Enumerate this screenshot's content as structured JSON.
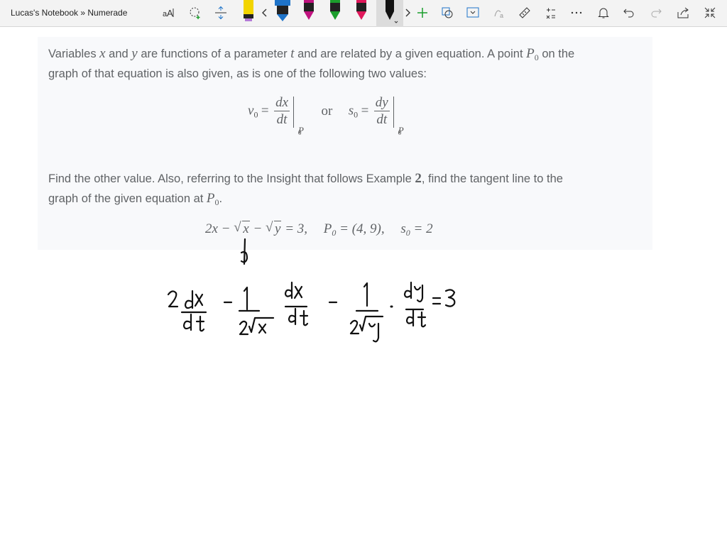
{
  "toolbar": {
    "title": "Lucas's Notebook » Numerade",
    "icons": [
      "text-format-icon",
      "lasso-select-icon",
      "insert-space-icon",
      "highlighter-yellow-icon",
      "scroll-left-icon",
      "pen-blue-icon",
      "pen-magenta-icon",
      "pen-green-icon",
      "pen-pink-icon",
      "pen-black-icon",
      "scroll-right-icon",
      "add-pen-icon",
      "ink-to-shape-icon",
      "ink-to-math-icon",
      "ink-replay-icon",
      "ruler-icon",
      "math-icon",
      "more-icon",
      "bell-icon",
      "undo-icon",
      "redo-icon",
      "share-icon",
      "fullscreen-icon"
    ],
    "colors": {
      "blue": "#1e73c8",
      "magenta": "#c0137f",
      "green": "#1b9e2c",
      "pink": "#e0185b",
      "black": "#111111",
      "yellow": "#f2d400"
    }
  },
  "problem": {
    "line1": {
      "a": "Variables ",
      "x": "x",
      "b": " and ",
      "y": "y",
      "c": " are functions of a parameter ",
      "t": "t",
      "d": " and are related by a given equation. A point ",
      "P": "P",
      "P_sub": "0",
      "e": " on the"
    },
    "line2": "graph of that equation is also given, as is one of the following two values:",
    "formula": {
      "v0": "v",
      "v0_sub": "0",
      "eq": "=",
      "dx": "dx",
      "dt": "dt",
      "eval": "P",
      "eval_sub": "0",
      "or": "or",
      "s0": "s",
      "s0_sub": "0",
      "dy": "dy",
      "dt2": "dt",
      "eval2": "P",
      "eval2_sub": "0"
    },
    "line3": {
      "a": "Find the other value. Also, referring to the Insight that follows Example ",
      "num": "2",
      "b": ", find the tangent line to the"
    },
    "line4": {
      "a": "graph of the given equation at ",
      "P": "P",
      "P_sub": "0",
      "b": "."
    },
    "given": {
      "p1": "2x − ",
      "sx": "x",
      "p2": " − ",
      "sy": "y",
      "p3": " = 3,",
      "P": "P",
      "P_sub": "0",
      "p4": " = (4, 9),",
      "s": "s",
      "s_sub": "0",
      "p5": " = 2"
    }
  },
  "handwriting": {
    "color": "#111111",
    "text": "2 dx/dt − 1/(2√x) · dx/dt − 1/(2√y) · dy/dt = 3"
  }
}
